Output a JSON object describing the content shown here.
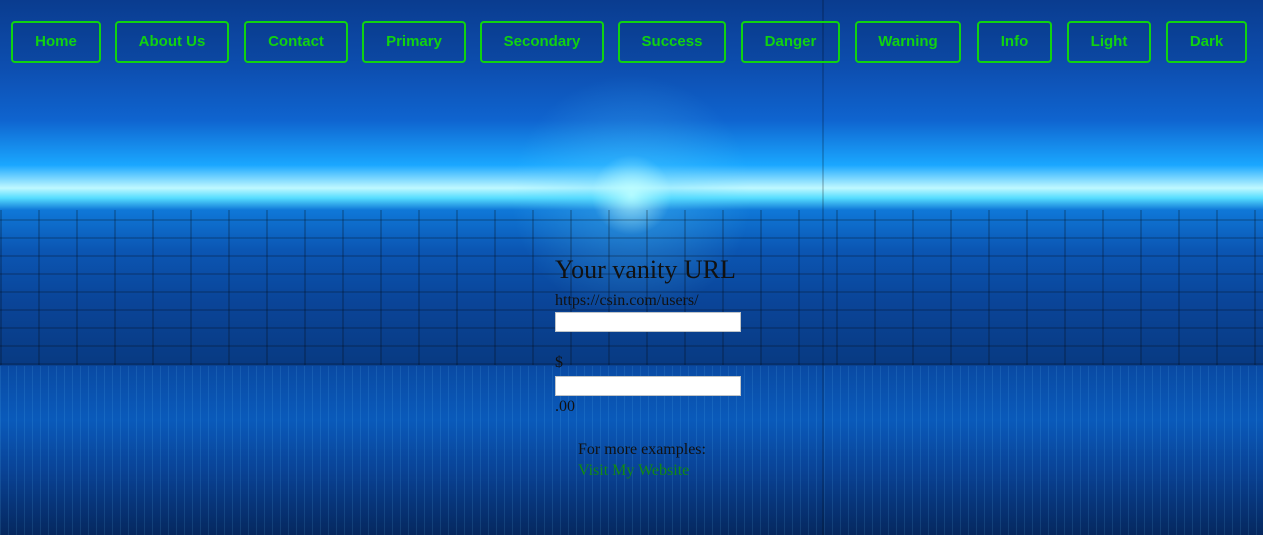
{
  "nav": [
    {
      "label": "Home"
    },
    {
      "label": "About Us"
    },
    {
      "label": "Contact"
    },
    {
      "label": "Primary"
    },
    {
      "label": "Secondary"
    },
    {
      "label": "Success"
    },
    {
      "label": "Danger"
    },
    {
      "label": "Warning"
    },
    {
      "label": "Info"
    },
    {
      "label": "Light"
    },
    {
      "label": "Dark"
    }
  ],
  "main": {
    "title": "Your vanity URL",
    "url_prefix": "https://csin.com/users/",
    "url_input_value": "",
    "currency_symbol": "$",
    "amount_input_value": "",
    "cents_suffix": ".00",
    "examples_label": "For more examples:",
    "examples_link": "Visit My Website"
  },
  "colors": {
    "accent": "#10d310",
    "link": "#118a11",
    "text": "#111111"
  }
}
